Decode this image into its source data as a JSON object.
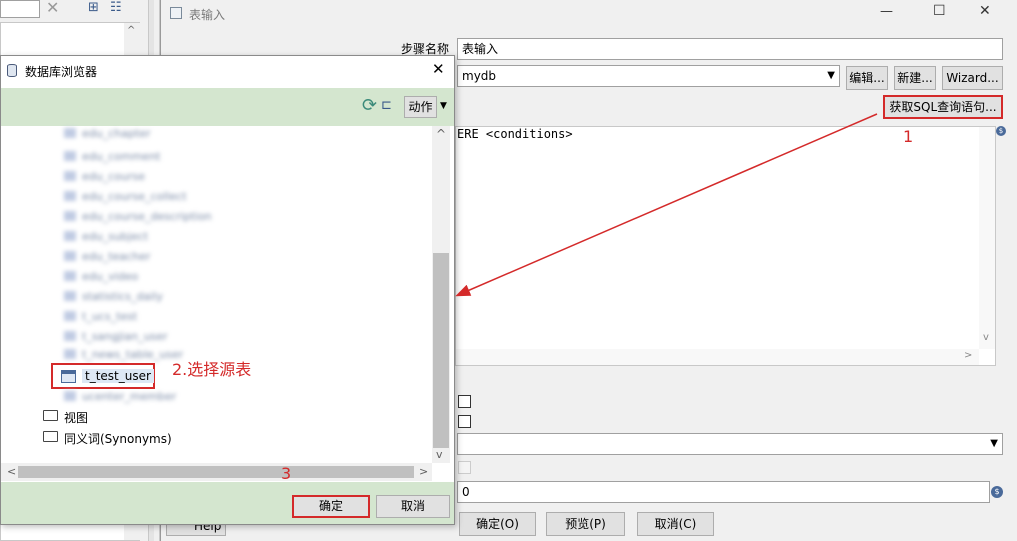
{
  "main_window": {
    "title": "表输入",
    "window_icon": "table-input-icon",
    "minimize_glyph": "—",
    "maximize_glyph": "☐",
    "close_glyph": "✕",
    "step_name_label": "步骤名称",
    "step_name_value": "表输入",
    "connection_value": "mydb",
    "edit_label": "编辑...",
    "new_label": "新建...",
    "wizard_label": "Wizard...",
    "get_sql_label": "获取SQL查询语句...",
    "sql_text": "ERE <conditions>",
    "limit_value": "0",
    "ok_label": "确定(O)",
    "preview_label": "预览(P)",
    "cancel_label": "取消(C)",
    "help_label": "Help"
  },
  "db_browser": {
    "title": "数据库浏览器",
    "actions_label": "动作",
    "blurred_tables": [
      "edu_chapter",
      "edu_comment",
      "edu_course",
      "edu_course_collect",
      "edu_course_description",
      "edu_subject",
      "edu_teacher",
      "edu_video",
      "statistics_daily",
      "t_ucs_test",
      "t_sangjian_user",
      "t_news_table_user"
    ],
    "selected_table": "t_test_user",
    "blurred_after": "ucenter_member",
    "views_label": "视图",
    "synonyms_label": "同义词(Synonyms)",
    "ok_label": "确定",
    "cancel_label": "取消"
  },
  "annotations": {
    "label_1": "1",
    "label_2": "2.选择源表",
    "label_3": "3",
    "color": "#d42a2a"
  }
}
